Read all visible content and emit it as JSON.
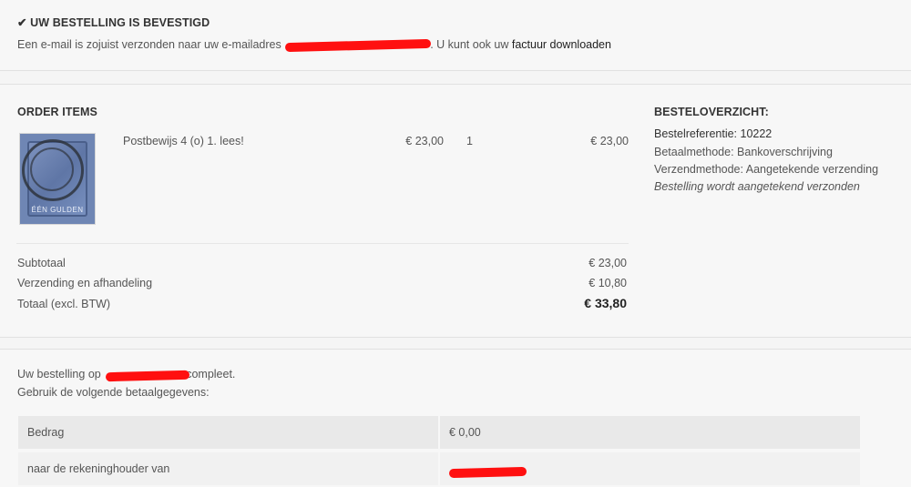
{
  "confirmation": {
    "title": "UW BESTELLING IS BEVESTIGD",
    "text_before_link": "Een e-mail is zojuist verzonden naar uw e-mailadres",
    "text_after_email": ". U kunt ook uw",
    "invoice_link_label": "factuur downloaden"
  },
  "order_items": {
    "heading": "ORDER ITEMS",
    "items": [
      {
        "name": "Postbewijs 4 (o) 1. lees!",
        "unit_price": "€ 23,00",
        "quantity": "1",
        "total": "€ 23,00",
        "stamp_text": "ÉÉN GULDEN"
      }
    ],
    "totals": [
      {
        "label": "Subtotaal",
        "value": "€ 23,00"
      },
      {
        "label": "Verzending en afhandeling",
        "value": "€ 10,80"
      },
      {
        "label": "Totaal (excl. BTW)",
        "value": "€ 33,80"
      }
    ]
  },
  "overview": {
    "heading": "BESTELOVERZICHT:",
    "reference": "Bestelreferentie: 10222",
    "payment_method": "Betaalmethode: Bankoverschrijving",
    "shipping_method": "Verzendmethode: Aangetekende verzending",
    "note": "Bestelling wordt aangetekend verzonden"
  },
  "payment": {
    "line1_before": "Uw bestelling op",
    "line1_after": "compleet.",
    "line2": "Gebruik de volgende betaalgegevens:",
    "rows": [
      {
        "label": "Bedrag",
        "value": "€ 0,00"
      },
      {
        "label": "naar de rekeninghouder van",
        "value": ""
      }
    ]
  },
  "colors": {
    "redaction": "#ff1010",
    "row_bg": "#e9e9e9",
    "row_bg_alt": "#f1f1f1"
  },
  "icons": {
    "confirmation_icon": "checkmark-icon"
  }
}
